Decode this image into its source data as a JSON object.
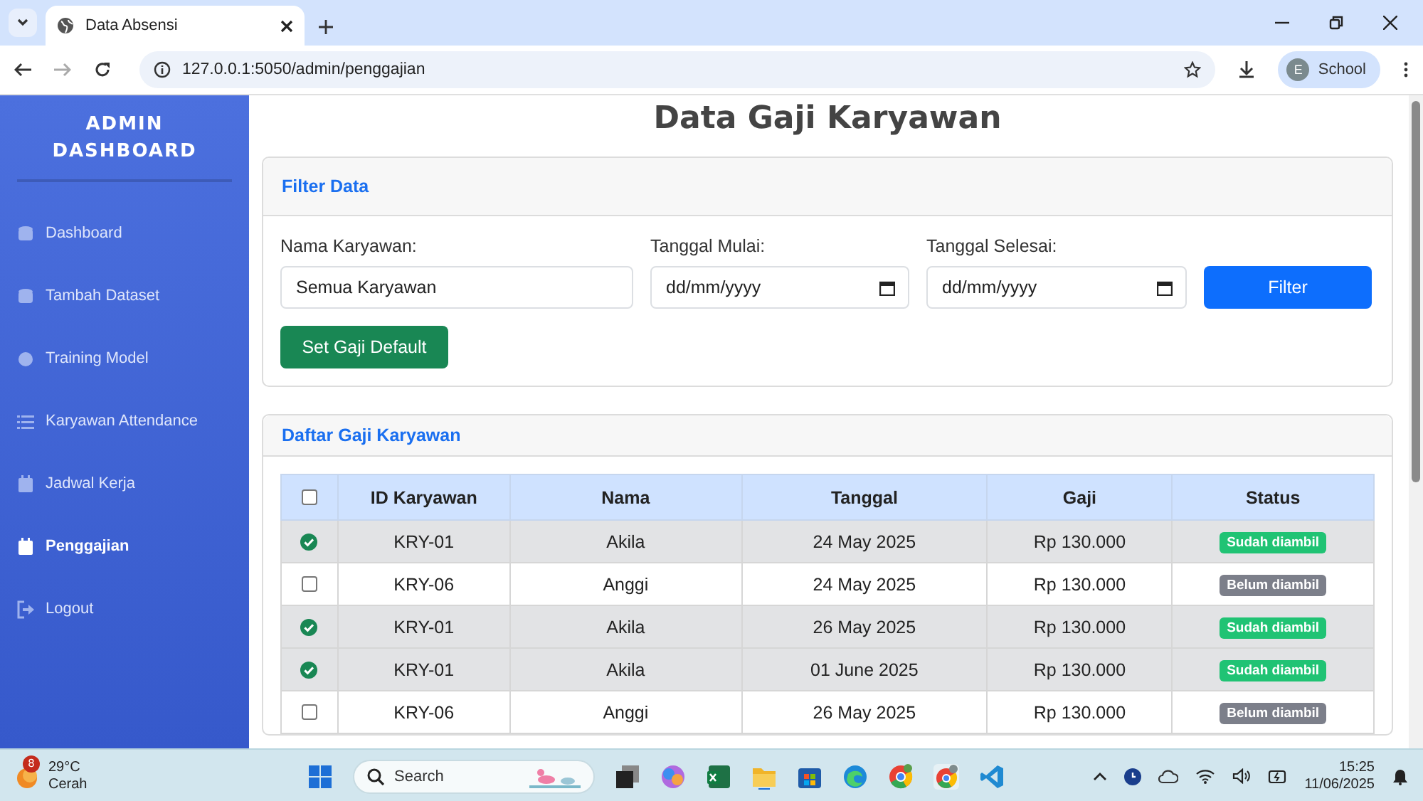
{
  "browser": {
    "tabs": [
      {
        "title": "Data Absensi",
        "selected": true
      }
    ],
    "url": "127.0.0.1:5050/admin/penggajian",
    "profile": {
      "initial": "E",
      "name": "School"
    }
  },
  "sidebar": {
    "title": "ADMIN DASHBOARD",
    "items": [
      {
        "label": "Dashboard",
        "selected": false
      },
      {
        "label": "Tambah Dataset",
        "selected": false
      },
      {
        "label": "Training Model",
        "selected": false
      },
      {
        "label": "Karyawan Attendance",
        "selected": false
      },
      {
        "label": "Jadwal Kerja",
        "selected": false
      },
      {
        "label": "Penggajian",
        "selected": true
      },
      {
        "label": "Logout",
        "selected": false
      }
    ]
  },
  "page_title": "Data Gaji Karyawan",
  "filter": {
    "title": "Filter Data",
    "fields": [
      {
        "label": "Nama Karyawan:",
        "kind": "select",
        "value": "Semua Karyawan"
      },
      {
        "label": "Tanggal Mulai:",
        "kind": "date",
        "placeholder": "dd/mm/yyyy"
      },
      {
        "label": "Tanggal Selesai:",
        "kind": "date",
        "placeholder": "dd/mm/yyyy"
      }
    ],
    "filter_button": "Filter",
    "default_button": "Set Gaji Default"
  },
  "table": {
    "title": "Daftar Gaji Karyawan",
    "all_checked": false,
    "columns": [
      "ID Karyawan",
      "Nama",
      "Tanggal",
      "Gaji",
      "Status"
    ],
    "rows": [
      {
        "checked": true,
        "id": "KRY-01",
        "name": "Akila",
        "date": "24 May 2025",
        "salary": "Rp 130.000",
        "status": "Sudah diambil",
        "kind": "taken"
      },
      {
        "checked": false,
        "id": "KRY-06",
        "name": "Anggi",
        "date": "24 May 2025",
        "salary": "Rp 130.000",
        "status": "Belum diambil",
        "kind": "pending"
      },
      {
        "checked": true,
        "id": "KRY-01",
        "name": "Akila",
        "date": "26 May 2025",
        "salary": "Rp 130.000",
        "status": "Sudah diambil",
        "kind": "taken"
      },
      {
        "checked": true,
        "id": "KRY-01",
        "name": "Akila",
        "date": "01 June 2025",
        "salary": "Rp 130.000",
        "status": "Sudah diambil",
        "kind": "taken"
      },
      {
        "checked": false,
        "id": "KRY-06",
        "name": "Anggi",
        "date": "26 May 2025",
        "salary": "Rp 130.000",
        "status": "Belum diambil",
        "kind": "pending"
      }
    ]
  },
  "taskbar": {
    "weather": {
      "badge": "8",
      "temperature": "29°C",
      "condition": "Cerah"
    },
    "search": {
      "placeholder": "Search"
    },
    "time": "15:25",
    "date": "11/06/2025"
  }
}
